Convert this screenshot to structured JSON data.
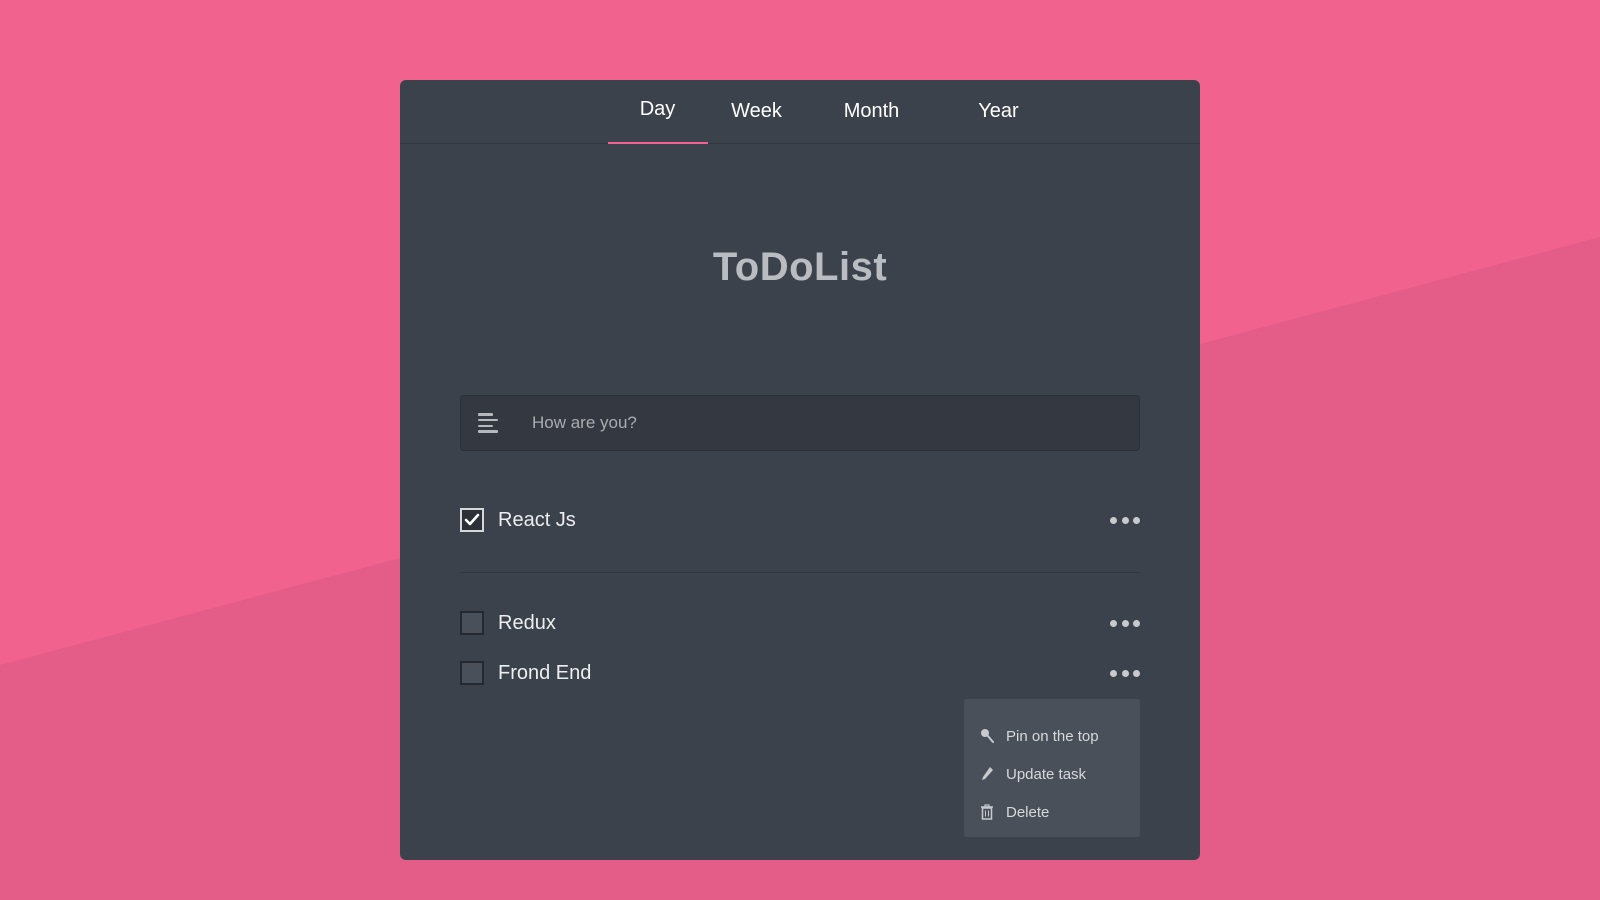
{
  "colors": {
    "background": "#f2628f",
    "background_shade": "#e35d88",
    "card": "#3c424b",
    "accent": "#f2628f"
  },
  "tabs": [
    {
      "label": "Day",
      "active": true
    },
    {
      "label": "Week",
      "active": false
    },
    {
      "label": "Month",
      "active": false
    },
    {
      "label": "Year",
      "active": false
    }
  ],
  "app": {
    "title": "ToDoList"
  },
  "input": {
    "placeholder": "How are you?",
    "value": ""
  },
  "tasks": [
    {
      "label": "React Js",
      "checked": true
    },
    {
      "label": "Redux",
      "checked": false
    },
    {
      "label": "Frond End",
      "checked": false
    }
  ],
  "dropdown": {
    "items": [
      {
        "label": "Pin on the top",
        "icon": "pin-icon"
      },
      {
        "label": "Update task",
        "icon": "pencil-icon"
      },
      {
        "label": "Delete",
        "icon": "trash-icon"
      }
    ]
  }
}
